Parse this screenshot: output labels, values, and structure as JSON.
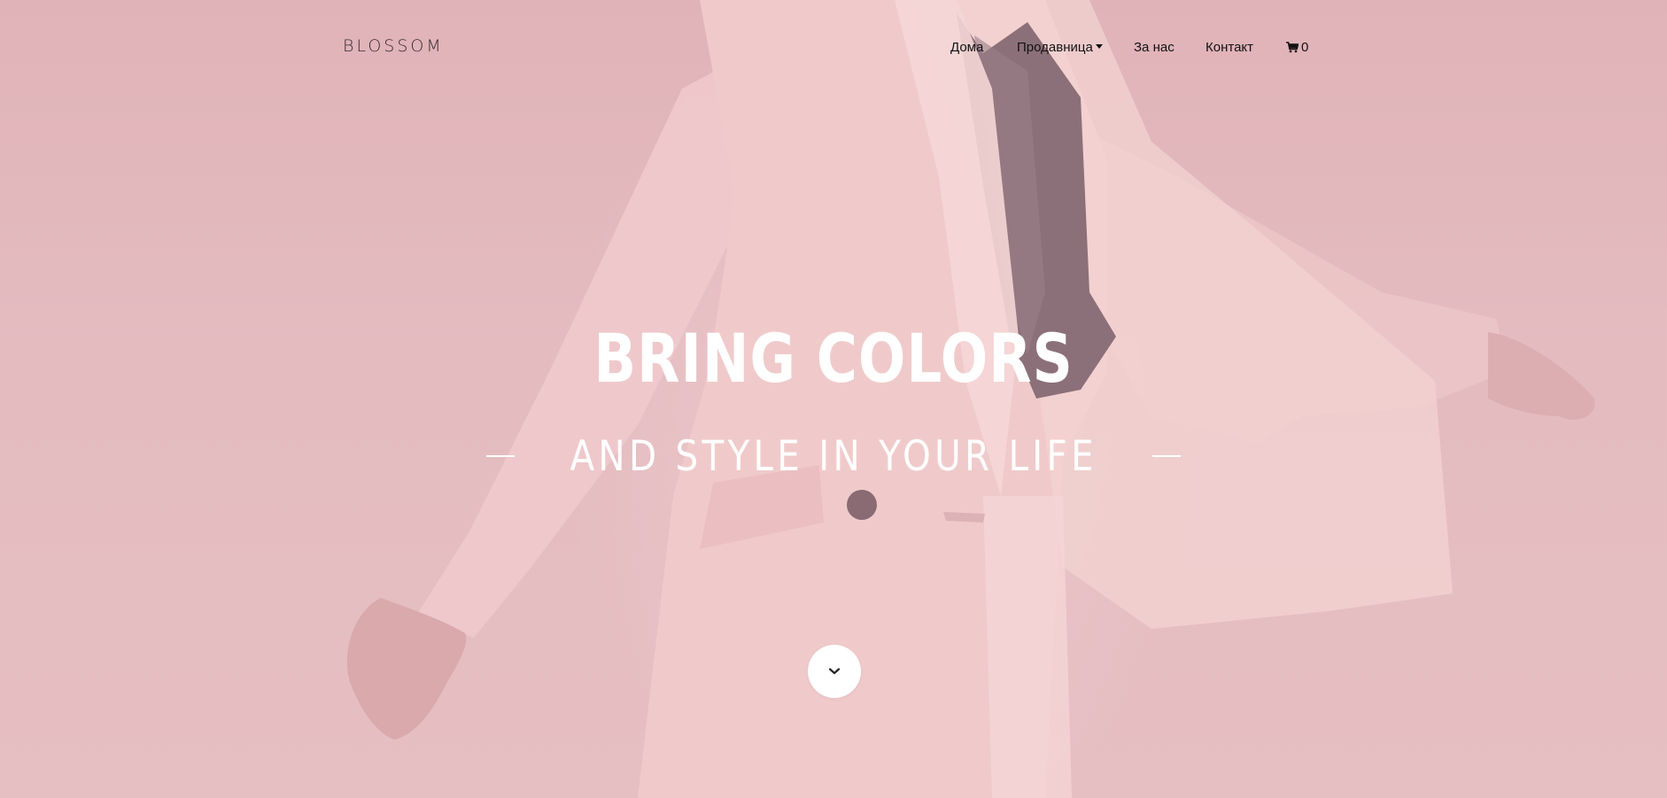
{
  "brand": {
    "logo": "BLOSSOM"
  },
  "nav": {
    "home": "Дома",
    "shop": "Продавница",
    "about": "За нас",
    "contact": "Контакт",
    "cart_count": "0"
  },
  "hero": {
    "title": "BRING COLORS",
    "subtitle": "AND STYLE IN YOUR LIFE",
    "scroll_icon": "chevron-down-icon"
  },
  "colors": {
    "background": "#e3b9bd",
    "hero_text": "#ffffff",
    "nav_text": "#111111",
    "blouse": "#8c7079"
  }
}
